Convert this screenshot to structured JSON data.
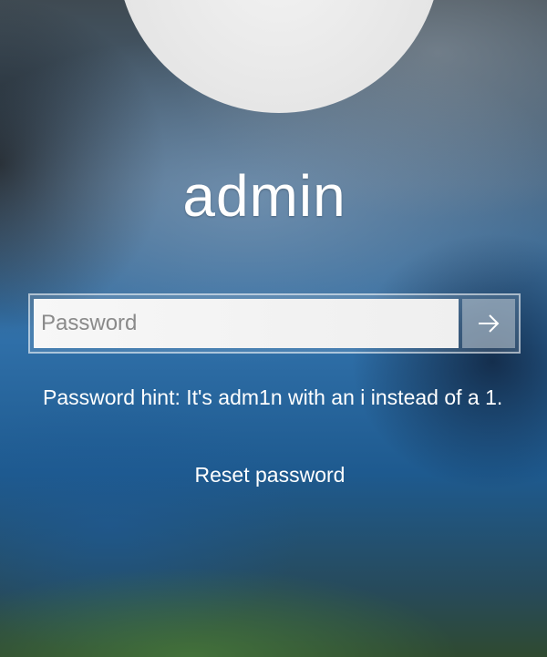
{
  "user": {
    "name": "admin",
    "avatar_icon": "default-user-avatar-icon"
  },
  "password": {
    "placeholder": "Password",
    "value": "",
    "submit_icon": "arrow-right-icon"
  },
  "hint": {
    "text": "Password hint: It's adm1n with an i instead of a 1."
  },
  "links": {
    "reset_password": "Reset password"
  }
}
